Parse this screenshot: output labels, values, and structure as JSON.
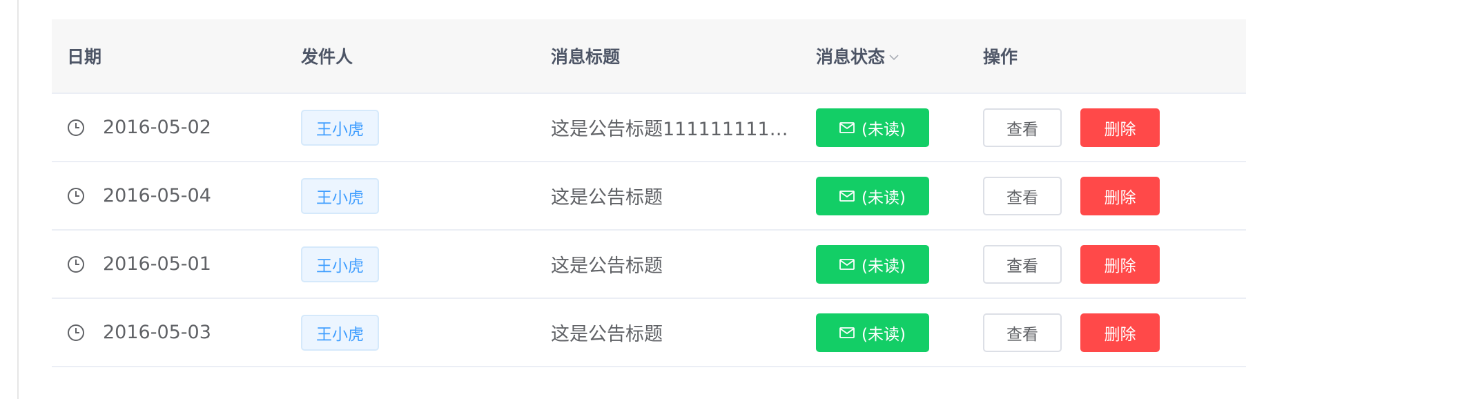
{
  "table": {
    "headers": {
      "date": "日期",
      "sender": "发件人",
      "title": "消息标题",
      "status": "消息状态",
      "actions": "操作"
    },
    "rows": [
      {
        "date": "2016-05-02",
        "sender": "王小虎",
        "title": "这是公告标题1111111111111",
        "status": "(未读)",
        "view": "查看",
        "delete": "删除"
      },
      {
        "date": "2016-05-04",
        "sender": "王小虎",
        "title": "这是公告标题",
        "status": "(未读)",
        "view": "查看",
        "delete": "删除"
      },
      {
        "date": "2016-05-01",
        "sender": "王小虎",
        "title": "这是公告标题",
        "status": "(未读)",
        "view": "查看",
        "delete": "删除"
      },
      {
        "date": "2016-05-03",
        "sender": "王小虎",
        "title": "这是公告标题",
        "status": "(未读)",
        "view": "查看",
        "delete": "删除"
      }
    ]
  },
  "icons": {
    "date": "clock-icon",
    "status": "mail-icon",
    "sort": "chevron-down-icon"
  },
  "colors": {
    "header_bg": "#f7f7f7",
    "tag_text": "#409eff",
    "tag_bg": "#ecf5ff",
    "status_green": "#13ce66",
    "delete_red": "#ff4949"
  }
}
